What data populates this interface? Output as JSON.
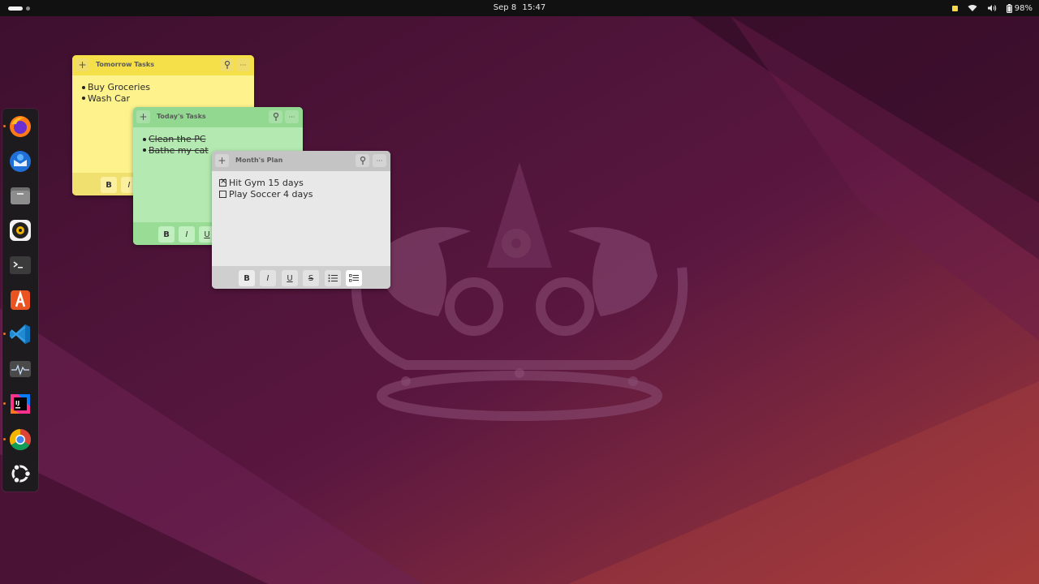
{
  "topbar": {
    "date": "Sep 8",
    "time": "15:47",
    "battery_percent": "98%"
  },
  "dock": {
    "apps": [
      {
        "name": "Firefox",
        "icon": "firefox-icon"
      },
      {
        "name": "Thunderbird",
        "icon": "thunderbird-icon"
      },
      {
        "name": "Files",
        "icon": "files-icon"
      },
      {
        "name": "Rhythmbox",
        "icon": "rhythmbox-icon"
      },
      {
        "name": "Terminal",
        "icon": "terminal-icon"
      },
      {
        "name": "App Center",
        "icon": "app-center-icon"
      },
      {
        "name": "Visual Studio Code",
        "icon": "vscode-icon"
      },
      {
        "name": "System Monitor",
        "icon": "system-monitor-icon"
      },
      {
        "name": "IntelliJ IDEA",
        "icon": "intellij-icon"
      },
      {
        "name": "Google Chrome",
        "icon": "chrome-icon"
      },
      {
        "name": "Show Apps",
        "icon": "ubuntu-logo-icon"
      }
    ]
  },
  "notes": {
    "tomorrow": {
      "title": "Tomorrow Tasks",
      "items": [
        "Buy Groceries",
        "Wash Car"
      ],
      "color": "#f9ec6c"
    },
    "today": {
      "title": "Today's Tasks",
      "items": [
        "Clean the PC",
        "Bathe my cat"
      ],
      "color": "#a9e3a6"
    },
    "month": {
      "title": "Month's Plan",
      "items": [
        {
          "text": "Hit Gym 15 days",
          "checked": true
        },
        {
          "text": "Play Soccer 4 days",
          "checked": false
        }
      ],
      "color": "#e6e6e6"
    }
  },
  "toolbar": {
    "bold": "B",
    "italic": "I",
    "underline": "U",
    "strikethrough": "S",
    "add": "+",
    "more": "···"
  }
}
